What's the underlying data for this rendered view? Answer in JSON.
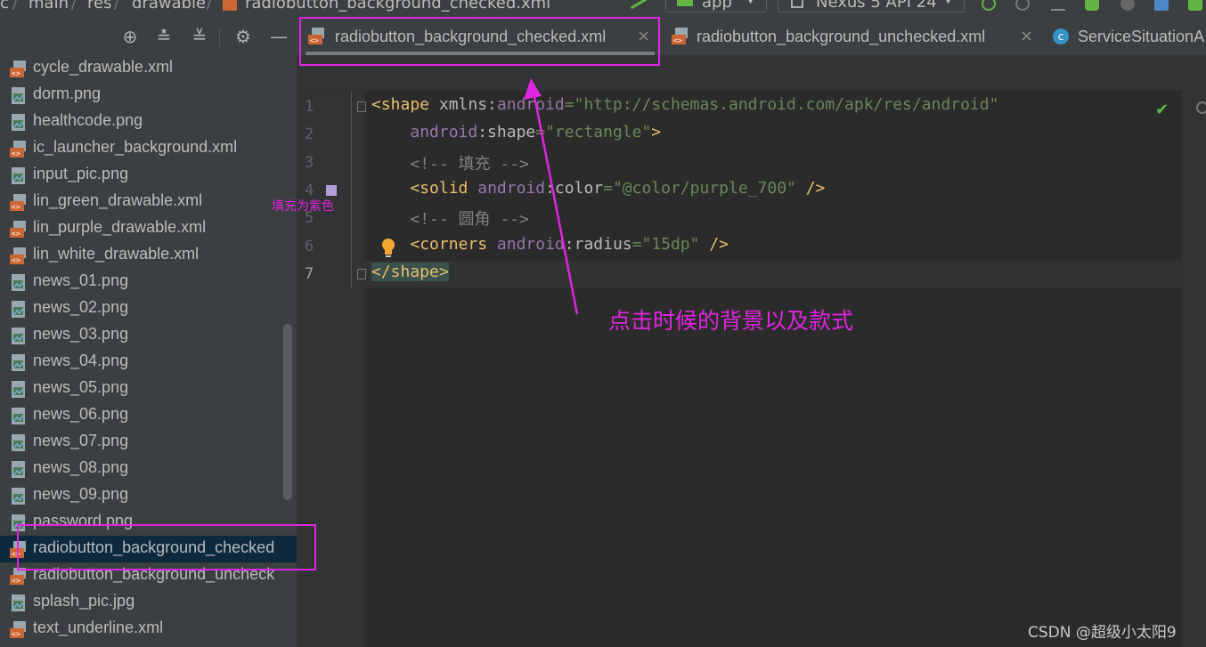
{
  "breadcrumb": [
    "c",
    "main",
    "res",
    "drawable",
    "radiobutton_background_checked.xml"
  ],
  "toolbar": {
    "run_config": "app",
    "device": "Nexus 5 API 24"
  },
  "project_panel": {
    "files": [
      {
        "name": "cycle_drawable.xml",
        "type": "xml"
      },
      {
        "name": "dorm.png",
        "type": "png"
      },
      {
        "name": "healthcode.png",
        "type": "png"
      },
      {
        "name": "ic_launcher_background.xml",
        "type": "xml"
      },
      {
        "name": "input_pic.png",
        "type": "png"
      },
      {
        "name": "lin_green_drawable.xml",
        "type": "xml"
      },
      {
        "name": "lin_purple_drawable.xml",
        "type": "xml"
      },
      {
        "name": "lin_white_drawable.xml",
        "type": "xml"
      },
      {
        "name": "news_01.png",
        "type": "png"
      },
      {
        "name": "news_02.png",
        "type": "png"
      },
      {
        "name": "news_03.png",
        "type": "png"
      },
      {
        "name": "news_04.png",
        "type": "png"
      },
      {
        "name": "news_05.png",
        "type": "png"
      },
      {
        "name": "news_06.png",
        "type": "png"
      },
      {
        "name": "news_07.png",
        "type": "png"
      },
      {
        "name": "news_08.png",
        "type": "png"
      },
      {
        "name": "news_09.png",
        "type": "png"
      },
      {
        "name": "password.png",
        "type": "png"
      },
      {
        "name": "radiobutton_background_checked",
        "type": "xml",
        "selected": true
      },
      {
        "name": "radiobutton_background_uncheck",
        "type": "xml"
      },
      {
        "name": "splash_pic.jpg",
        "type": "png"
      },
      {
        "name": "text_underline.xml",
        "type": "xml"
      }
    ]
  },
  "tabs": [
    {
      "label": "radiobutton_background_checked.xml",
      "active": true,
      "closable": true
    },
    {
      "label": "radiobutton_background_unchecked.xml",
      "active": false,
      "closable": true
    },
    {
      "label": "ServiceSituationA",
      "active": false,
      "closable": false
    }
  ],
  "editor": {
    "line_numbers": [
      "1",
      "2",
      "3",
      "4",
      "5",
      "6",
      "7"
    ],
    "current_line": "7",
    "lines": [
      [
        {
          "t": "<shape",
          "c": "tag"
        },
        {
          "t": " xmlns:",
          "c": "attr"
        },
        {
          "t": "android",
          "c": "ns"
        },
        {
          "t": "=\"http://schemas.android.com/apk/res/android\"",
          "c": "str"
        }
      ],
      [
        {
          "t": "    "
        },
        {
          "t": "android",
          "c": "ns"
        },
        {
          "t": ":shape",
          "c": "attr"
        },
        {
          "t": "=\"rectangle\"",
          "c": "str"
        },
        {
          "t": ">",
          "c": "tag"
        }
      ],
      [
        {
          "t": "    "
        },
        {
          "t": "<!-- 填充 -->",
          "c": "cmt"
        }
      ],
      [
        {
          "t": "    "
        },
        {
          "t": "<solid",
          "c": "tag"
        },
        {
          "t": " "
        },
        {
          "t": "android",
          "c": "ns"
        },
        {
          "t": ":color",
          "c": "attr"
        },
        {
          "t": "=\"@color/purple_700\"",
          "c": "str"
        },
        {
          "t": " />",
          "c": "tag"
        }
      ],
      [
        {
          "t": "    "
        },
        {
          "t": "<!-- 圆角 -->",
          "c": "cmt"
        }
      ],
      [
        {
          "t": "    "
        },
        {
          "t": "<corners",
          "c": "tag"
        },
        {
          "t": " "
        },
        {
          "t": "android",
          "c": "ns"
        },
        {
          "t": ":radius",
          "c": "attr"
        },
        {
          "t": "=\"15dp\"",
          "c": "str"
        },
        {
          "t": " />",
          "c": "tag"
        }
      ],
      [
        {
          "t": "</shape>",
          "c": "tag tagbg"
        }
      ]
    ],
    "color_swatch": "#b39ddb"
  },
  "annotations": {
    "fill_note": "填充为紫色",
    "main_note": "点击时候的背景以及款式",
    "accent": "#e025e0"
  },
  "watermark": "CSDN @超级小太阳9"
}
